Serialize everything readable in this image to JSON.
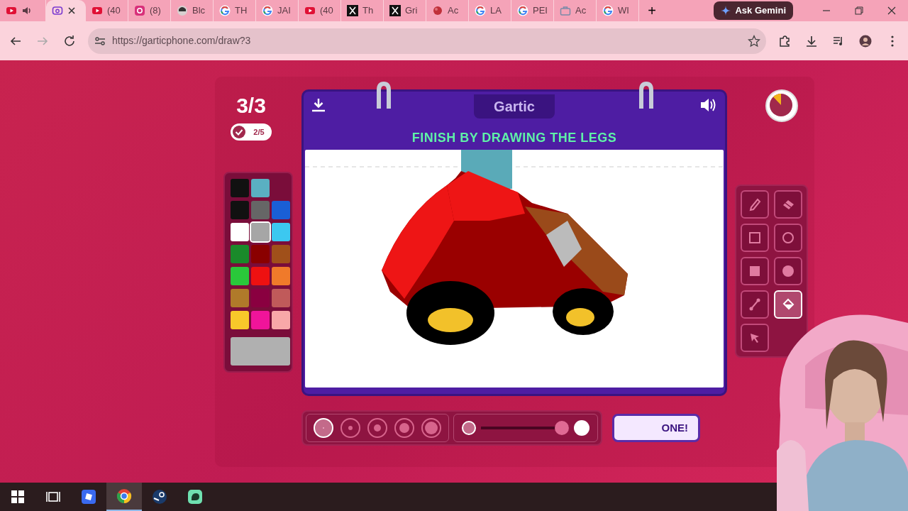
{
  "browser": {
    "tabs": [
      {
        "kind": "youtube",
        "audio": true,
        "selected": false
      },
      {
        "kind": "phone",
        "audio": false,
        "selected": true
      },
      {
        "kind": "youtube",
        "title": "(40",
        "audio": false,
        "selected": false
      },
      {
        "kind": "instagram",
        "title": "(8)",
        "audio": false,
        "selected": false
      },
      {
        "kind": "avatar",
        "title": "Blc",
        "audio": false,
        "selected": false
      },
      {
        "kind": "google",
        "title": "TH",
        "audio": false,
        "selected": false
      },
      {
        "kind": "google",
        "title": "JAI",
        "audio": false,
        "selected": false
      },
      {
        "kind": "youtube",
        "title": "(40",
        "audio": false,
        "selected": false
      },
      {
        "kind": "x",
        "title": "Th",
        "audio": false,
        "selected": false
      },
      {
        "kind": "x",
        "title": "Gri",
        "audio": false,
        "selected": false
      },
      {
        "kind": "ball",
        "title": "Ac",
        "audio": false,
        "selected": false
      },
      {
        "kind": "google",
        "title": "LA",
        "audio": false,
        "selected": false
      },
      {
        "kind": "google",
        "title": "PEI",
        "audio": false,
        "selected": false
      },
      {
        "kind": "briefcase",
        "title": "Ac",
        "audio": false,
        "selected": false
      },
      {
        "kind": "google",
        "title": "WI",
        "audio": false,
        "selected": false
      }
    ],
    "new_tab": "+",
    "ask_gemini": "Ask Gemini",
    "url": "https://garticphone.com/draw?3"
  },
  "game": {
    "round": "3/3",
    "done_count": "2/5",
    "logo": "Gartic",
    "instruction": "FINISH BY DRAWING THE LEGS",
    "recent_colors": [
      {
        "color": "#111111"
      },
      {
        "color": "#5ab0c2"
      }
    ],
    "palette": [
      {
        "color": "#111111",
        "selected": false
      },
      {
        "color": "#666666",
        "selected": false
      },
      {
        "color": "#1a5fd6",
        "selected": false
      },
      {
        "color": "#ffffff",
        "selected": false
      },
      {
        "color": "#a6a6a6",
        "selected": true
      },
      {
        "color": "#3cc8f0",
        "selected": false
      },
      {
        "color": "#1a8a2a",
        "selected": false
      },
      {
        "color": "#8a0000",
        "selected": false
      },
      {
        "color": "#a0501a",
        "selected": false
      },
      {
        "color": "#2ac83a",
        "selected": false
      },
      {
        "color": "#ee1111",
        "selected": false
      },
      {
        "color": "#f07a2a",
        "selected": false
      },
      {
        "color": "#b07a2a",
        "selected": false
      },
      {
        "color": "#8a0040",
        "selected": false
      },
      {
        "color": "#c05a5a",
        "selected": false
      },
      {
        "color": "#f8c82a",
        "selected": false
      },
      {
        "color": "#f0149a",
        "selected": false
      },
      {
        "color": "#f8a8a8",
        "selected": false
      }
    ],
    "current_color": {
      "color": "#b0b0b0"
    },
    "tools": [
      {
        "kind": "pencil",
        "selected": false
      },
      {
        "kind": "eraser",
        "selected": false
      },
      {
        "kind": "rect",
        "selected": false
      },
      {
        "kind": "circle",
        "selected": false
      },
      {
        "kind": "rect-fill",
        "selected": false
      },
      {
        "kind": "circle-fill",
        "selected": false
      },
      {
        "kind": "line",
        "selected": false
      },
      {
        "kind": "bucket",
        "selected": true
      },
      {
        "kind": "arrow",
        "selected": false
      }
    ],
    "brush_sizes": [
      {
        "selected": true
      },
      {
        "selected": false
      },
      {
        "selected": false
      },
      {
        "selected": false
      },
      {
        "selected": false
      }
    ],
    "opacity": {
      "level": 0.92
    },
    "done_button": "ONE!"
  },
  "taskbar": {
    "apps": [
      {
        "kind": "windows",
        "active": false
      },
      {
        "kind": "taskview",
        "active": false
      },
      {
        "kind": "roblox",
        "active": false
      },
      {
        "kind": "chrome",
        "active": true
      },
      {
        "kind": "steam",
        "active": false
      },
      {
        "kind": "chat",
        "active": false
      }
    ]
  }
}
